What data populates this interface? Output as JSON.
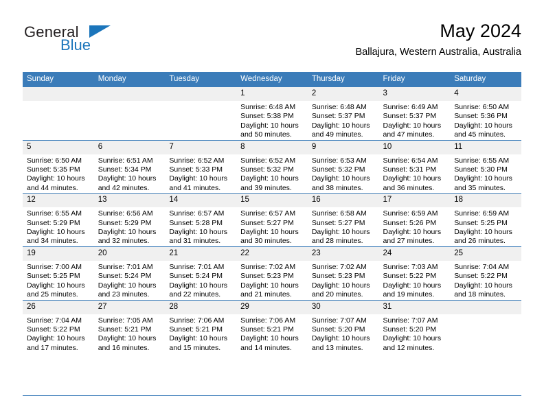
{
  "brand": {
    "name_part1": "General",
    "name_part2": "Blue",
    "triangle_icon": "triangle-icon",
    "color_dark": "#231f20",
    "color_blue": "#1b75bb"
  },
  "header": {
    "title": "May 2024",
    "subtitle": "Ballajura, Western Australia, Australia"
  },
  "colors": {
    "header_row_bg": "#3b7cb9",
    "daynum_bg": "#f0f0f0",
    "grid_line": "#3b7cb9",
    "text": "#000000"
  },
  "weekday_headers": [
    "Sunday",
    "Monday",
    "Tuesday",
    "Wednesday",
    "Thursday",
    "Friday",
    "Saturday"
  ],
  "weeks": [
    [
      {
        "day": "",
        "sunrise": "",
        "sunset": "",
        "daylight_line1": "",
        "daylight_line2": "",
        "empty": true
      },
      {
        "day": "",
        "sunrise": "",
        "sunset": "",
        "daylight_line1": "",
        "daylight_line2": "",
        "empty": true
      },
      {
        "day": "",
        "sunrise": "",
        "sunset": "",
        "daylight_line1": "",
        "daylight_line2": "",
        "empty": true
      },
      {
        "day": "1",
        "sunrise": "Sunrise: 6:48 AM",
        "sunset": "Sunset: 5:38 PM",
        "daylight_line1": "Daylight: 10 hours",
        "daylight_line2": "and 50 minutes.",
        "empty": false
      },
      {
        "day": "2",
        "sunrise": "Sunrise: 6:48 AM",
        "sunset": "Sunset: 5:37 PM",
        "daylight_line1": "Daylight: 10 hours",
        "daylight_line2": "and 49 minutes.",
        "empty": false
      },
      {
        "day": "3",
        "sunrise": "Sunrise: 6:49 AM",
        "sunset": "Sunset: 5:37 PM",
        "daylight_line1": "Daylight: 10 hours",
        "daylight_line2": "and 47 minutes.",
        "empty": false
      },
      {
        "day": "4",
        "sunrise": "Sunrise: 6:50 AM",
        "sunset": "Sunset: 5:36 PM",
        "daylight_line1": "Daylight: 10 hours",
        "daylight_line2": "and 45 minutes.",
        "empty": false
      }
    ],
    [
      {
        "day": "5",
        "sunrise": "Sunrise: 6:50 AM",
        "sunset": "Sunset: 5:35 PM",
        "daylight_line1": "Daylight: 10 hours",
        "daylight_line2": "and 44 minutes.",
        "empty": false
      },
      {
        "day": "6",
        "sunrise": "Sunrise: 6:51 AM",
        "sunset": "Sunset: 5:34 PM",
        "daylight_line1": "Daylight: 10 hours",
        "daylight_line2": "and 42 minutes.",
        "empty": false
      },
      {
        "day": "7",
        "sunrise": "Sunrise: 6:52 AM",
        "sunset": "Sunset: 5:33 PM",
        "daylight_line1": "Daylight: 10 hours",
        "daylight_line2": "and 41 minutes.",
        "empty": false
      },
      {
        "day": "8",
        "sunrise": "Sunrise: 6:52 AM",
        "sunset": "Sunset: 5:32 PM",
        "daylight_line1": "Daylight: 10 hours",
        "daylight_line2": "and 39 minutes.",
        "empty": false
      },
      {
        "day": "9",
        "sunrise": "Sunrise: 6:53 AM",
        "sunset": "Sunset: 5:32 PM",
        "daylight_line1": "Daylight: 10 hours",
        "daylight_line2": "and 38 minutes.",
        "empty": false
      },
      {
        "day": "10",
        "sunrise": "Sunrise: 6:54 AM",
        "sunset": "Sunset: 5:31 PM",
        "daylight_line1": "Daylight: 10 hours",
        "daylight_line2": "and 36 minutes.",
        "empty": false
      },
      {
        "day": "11",
        "sunrise": "Sunrise: 6:55 AM",
        "sunset": "Sunset: 5:30 PM",
        "daylight_line1": "Daylight: 10 hours",
        "daylight_line2": "and 35 minutes.",
        "empty": false
      }
    ],
    [
      {
        "day": "12",
        "sunrise": "Sunrise: 6:55 AM",
        "sunset": "Sunset: 5:29 PM",
        "daylight_line1": "Daylight: 10 hours",
        "daylight_line2": "and 34 minutes.",
        "empty": false
      },
      {
        "day": "13",
        "sunrise": "Sunrise: 6:56 AM",
        "sunset": "Sunset: 5:29 PM",
        "daylight_line1": "Daylight: 10 hours",
        "daylight_line2": "and 32 minutes.",
        "empty": false
      },
      {
        "day": "14",
        "sunrise": "Sunrise: 6:57 AM",
        "sunset": "Sunset: 5:28 PM",
        "daylight_line1": "Daylight: 10 hours",
        "daylight_line2": "and 31 minutes.",
        "empty": false
      },
      {
        "day": "15",
        "sunrise": "Sunrise: 6:57 AM",
        "sunset": "Sunset: 5:27 PM",
        "daylight_line1": "Daylight: 10 hours",
        "daylight_line2": "and 30 minutes.",
        "empty": false
      },
      {
        "day": "16",
        "sunrise": "Sunrise: 6:58 AM",
        "sunset": "Sunset: 5:27 PM",
        "daylight_line1": "Daylight: 10 hours",
        "daylight_line2": "and 28 minutes.",
        "empty": false
      },
      {
        "day": "17",
        "sunrise": "Sunrise: 6:59 AM",
        "sunset": "Sunset: 5:26 PM",
        "daylight_line1": "Daylight: 10 hours",
        "daylight_line2": "and 27 minutes.",
        "empty": false
      },
      {
        "day": "18",
        "sunrise": "Sunrise: 6:59 AM",
        "sunset": "Sunset: 5:25 PM",
        "daylight_line1": "Daylight: 10 hours",
        "daylight_line2": "and 26 minutes.",
        "empty": false
      }
    ],
    [
      {
        "day": "19",
        "sunrise": "Sunrise: 7:00 AM",
        "sunset": "Sunset: 5:25 PM",
        "daylight_line1": "Daylight: 10 hours",
        "daylight_line2": "and 25 minutes.",
        "empty": false
      },
      {
        "day": "20",
        "sunrise": "Sunrise: 7:01 AM",
        "sunset": "Sunset: 5:24 PM",
        "daylight_line1": "Daylight: 10 hours",
        "daylight_line2": "and 23 minutes.",
        "empty": false
      },
      {
        "day": "21",
        "sunrise": "Sunrise: 7:01 AM",
        "sunset": "Sunset: 5:24 PM",
        "daylight_line1": "Daylight: 10 hours",
        "daylight_line2": "and 22 minutes.",
        "empty": false
      },
      {
        "day": "22",
        "sunrise": "Sunrise: 7:02 AM",
        "sunset": "Sunset: 5:23 PM",
        "daylight_line1": "Daylight: 10 hours",
        "daylight_line2": "and 21 minutes.",
        "empty": false
      },
      {
        "day": "23",
        "sunrise": "Sunrise: 7:02 AM",
        "sunset": "Sunset: 5:23 PM",
        "daylight_line1": "Daylight: 10 hours",
        "daylight_line2": "and 20 minutes.",
        "empty": false
      },
      {
        "day": "24",
        "sunrise": "Sunrise: 7:03 AM",
        "sunset": "Sunset: 5:22 PM",
        "daylight_line1": "Daylight: 10 hours",
        "daylight_line2": "and 19 minutes.",
        "empty": false
      },
      {
        "day": "25",
        "sunrise": "Sunrise: 7:04 AM",
        "sunset": "Sunset: 5:22 PM",
        "daylight_line1": "Daylight: 10 hours",
        "daylight_line2": "and 18 minutes.",
        "empty": false
      }
    ],
    [
      {
        "day": "26",
        "sunrise": "Sunrise: 7:04 AM",
        "sunset": "Sunset: 5:22 PM",
        "daylight_line1": "Daylight: 10 hours",
        "daylight_line2": "and 17 minutes.",
        "empty": false
      },
      {
        "day": "27",
        "sunrise": "Sunrise: 7:05 AM",
        "sunset": "Sunset: 5:21 PM",
        "daylight_line1": "Daylight: 10 hours",
        "daylight_line2": "and 16 minutes.",
        "empty": false
      },
      {
        "day": "28",
        "sunrise": "Sunrise: 7:06 AM",
        "sunset": "Sunset: 5:21 PM",
        "daylight_line1": "Daylight: 10 hours",
        "daylight_line2": "and 15 minutes.",
        "empty": false
      },
      {
        "day": "29",
        "sunrise": "Sunrise: 7:06 AM",
        "sunset": "Sunset: 5:21 PM",
        "daylight_line1": "Daylight: 10 hours",
        "daylight_line2": "and 14 minutes.",
        "empty": false
      },
      {
        "day": "30",
        "sunrise": "Sunrise: 7:07 AM",
        "sunset": "Sunset: 5:20 PM",
        "daylight_line1": "Daylight: 10 hours",
        "daylight_line2": "and 13 minutes.",
        "empty": false
      },
      {
        "day": "31",
        "sunrise": "Sunrise: 7:07 AM",
        "sunset": "Sunset: 5:20 PM",
        "daylight_line1": "Daylight: 10 hours",
        "daylight_line2": "and 12 minutes.",
        "empty": false
      },
      {
        "day": "",
        "sunrise": "",
        "sunset": "",
        "daylight_line1": "",
        "daylight_line2": "",
        "empty": true
      }
    ]
  ]
}
